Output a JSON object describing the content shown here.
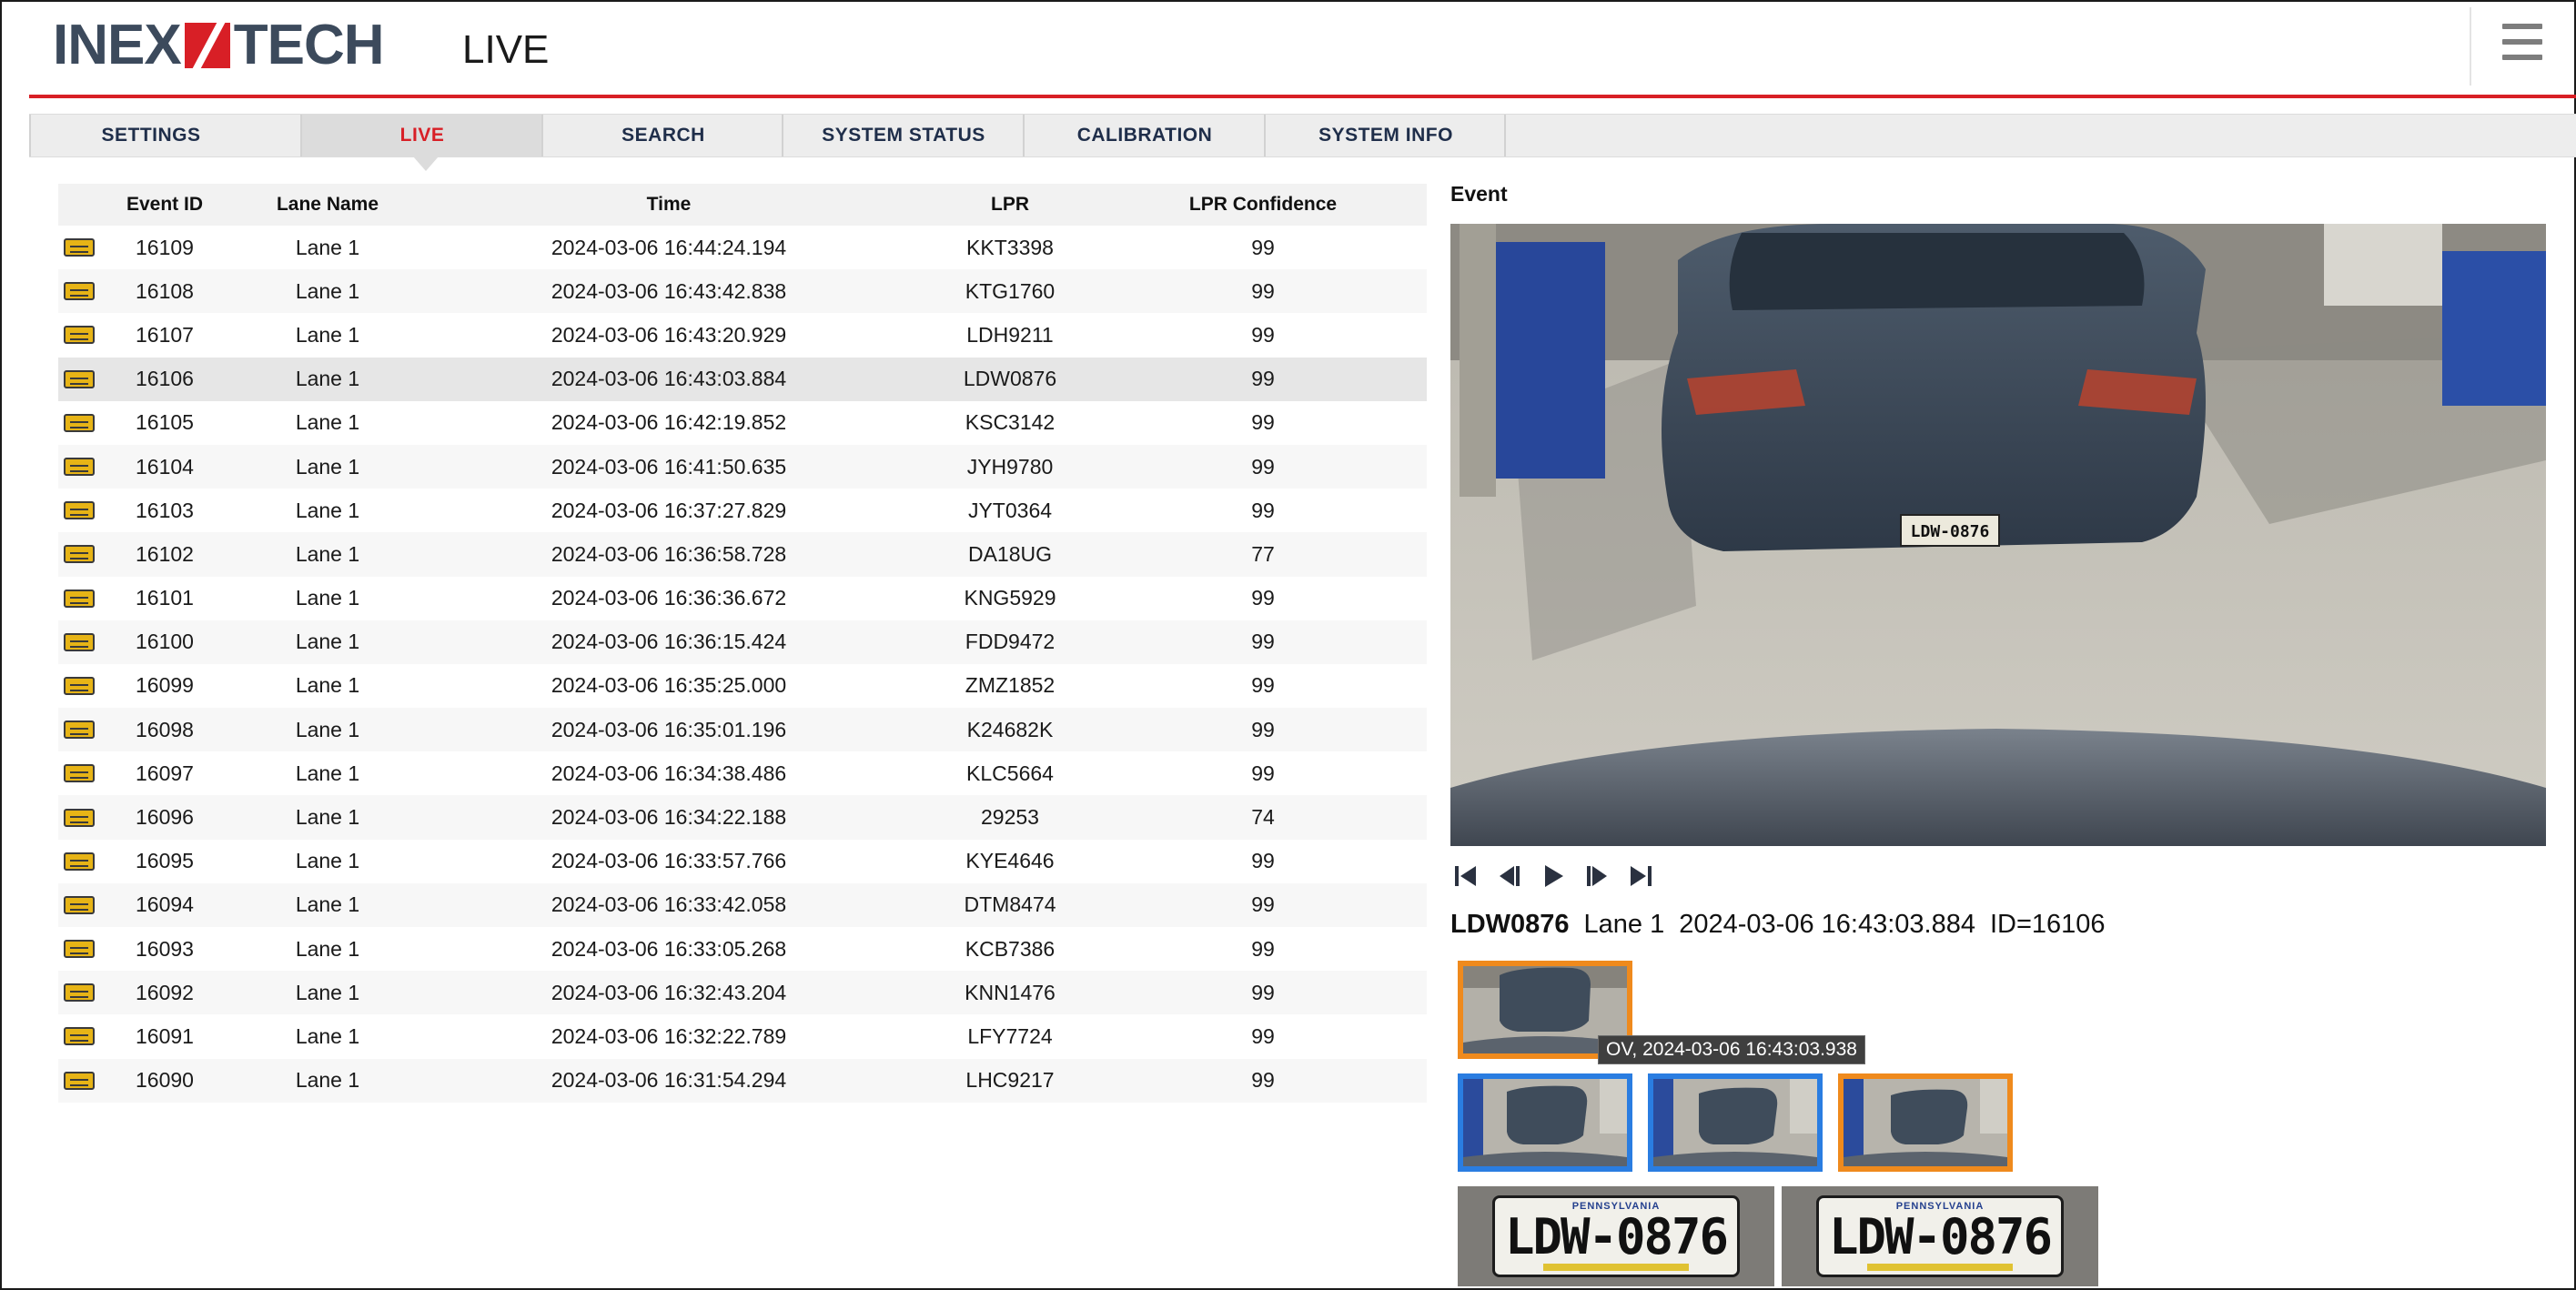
{
  "app": {
    "logo_left": "INEX",
    "logo_right": "TECH",
    "page_title": "LIVE",
    "menu_icon": "hamburger-menu-icon",
    "brand_color": "#d81f26"
  },
  "tabs": [
    {
      "label": "SETTINGS",
      "active": false
    },
    {
      "label": "LIVE",
      "active": true
    },
    {
      "label": "SEARCH",
      "active": false
    },
    {
      "label": "SYSTEM STATUS",
      "active": false
    },
    {
      "label": "CALIBRATION",
      "active": false
    },
    {
      "label": "SYSTEM INFO",
      "active": false
    }
  ],
  "events_table": {
    "columns": [
      "",
      "Event ID",
      "Lane Name",
      "Time",
      "LPR",
      "LPR Confidence"
    ],
    "row_icon": "license-plate-icon",
    "selected_event_id": "16106",
    "rows": [
      {
        "id": "16109",
        "lane": "Lane 1",
        "time": "2024-03-06 16:44:24.194",
        "lpr": "KKT3398",
        "confidence": "99"
      },
      {
        "id": "16108",
        "lane": "Lane 1",
        "time": "2024-03-06 16:43:42.838",
        "lpr": "KTG1760",
        "confidence": "99"
      },
      {
        "id": "16107",
        "lane": "Lane 1",
        "time": "2024-03-06 16:43:20.929",
        "lpr": "LDH9211",
        "confidence": "99"
      },
      {
        "id": "16106",
        "lane": "Lane 1",
        "time": "2024-03-06 16:43:03.884",
        "lpr": "LDW0876",
        "confidence": "99"
      },
      {
        "id": "16105",
        "lane": "Lane 1",
        "time": "2024-03-06 16:42:19.852",
        "lpr": "KSC3142",
        "confidence": "99"
      },
      {
        "id": "16104",
        "lane": "Lane 1",
        "time": "2024-03-06 16:41:50.635",
        "lpr": "JYH9780",
        "confidence": "99"
      },
      {
        "id": "16103",
        "lane": "Lane 1",
        "time": "2024-03-06 16:37:27.829",
        "lpr": "JYT0364",
        "confidence": "99"
      },
      {
        "id": "16102",
        "lane": "Lane 1",
        "time": "2024-03-06 16:36:58.728",
        "lpr": "DA18UG",
        "confidence": "77"
      },
      {
        "id": "16101",
        "lane": "Lane 1",
        "time": "2024-03-06 16:36:36.672",
        "lpr": "KNG5929",
        "confidence": "99"
      },
      {
        "id": "16100",
        "lane": "Lane 1",
        "time": "2024-03-06 16:36:15.424",
        "lpr": "FDD9472",
        "confidence": "99"
      },
      {
        "id": "16099",
        "lane": "Lane 1",
        "time": "2024-03-06 16:35:25.000",
        "lpr": "ZMZ1852",
        "confidence": "99"
      },
      {
        "id": "16098",
        "lane": "Lane 1",
        "time": "2024-03-06 16:35:01.196",
        "lpr": "K24682K",
        "confidence": "99"
      },
      {
        "id": "16097",
        "lane": "Lane 1",
        "time": "2024-03-06 16:34:38.486",
        "lpr": "KLC5664",
        "confidence": "99"
      },
      {
        "id": "16096",
        "lane": "Lane 1",
        "time": "2024-03-06 16:34:22.188",
        "lpr": "29253",
        "confidence": "74"
      },
      {
        "id": "16095",
        "lane": "Lane 1",
        "time": "2024-03-06 16:33:57.766",
        "lpr": "KYE4646",
        "confidence": "99"
      },
      {
        "id": "16094",
        "lane": "Lane 1",
        "time": "2024-03-06 16:33:42.058",
        "lpr": "DTM8474",
        "confidence": "99"
      },
      {
        "id": "16093",
        "lane": "Lane 1",
        "time": "2024-03-06 16:33:05.268",
        "lpr": "KCB7386",
        "confidence": "99"
      },
      {
        "id": "16092",
        "lane": "Lane 1",
        "time": "2024-03-06 16:32:43.204",
        "lpr": "KNN1476",
        "confidence": "99"
      },
      {
        "id": "16091",
        "lane": "Lane 1",
        "time": "2024-03-06 16:32:22.789",
        "lpr": "LFY7724",
        "confidence": "99"
      },
      {
        "id": "16090",
        "lane": "Lane 1",
        "time": "2024-03-06 16:31:54.294",
        "lpr": "LHC9217",
        "confidence": "99"
      }
    ]
  },
  "event_panel": {
    "heading": "Event",
    "controls": [
      "skip-to-first-icon",
      "step-back-icon",
      "play-icon",
      "step-forward-icon",
      "skip-to-last-icon"
    ],
    "caption": {
      "plate": "LDW0876",
      "lane": "Lane 1",
      "time": "2024-03-06 16:43:03.884",
      "id": "ID=16106"
    },
    "thumbnails": [
      {
        "frame": "overview",
        "border_color": "#ef8a1d"
      },
      {
        "frame": "image-2",
        "border_color": "#2a7de1"
      },
      {
        "frame": "image-3",
        "border_color": "#2a7de1"
      },
      {
        "frame": "image-4",
        "border_color": "#ef8a1d"
      }
    ],
    "tooltip": "OV, 2024-03-06 16:43:03.938",
    "plate_crops": [
      {
        "text": "LDW-0876",
        "state": "PENNSYLVANIA"
      },
      {
        "text": "LDW-0876",
        "state": "PENNSYLVANIA"
      }
    ]
  }
}
